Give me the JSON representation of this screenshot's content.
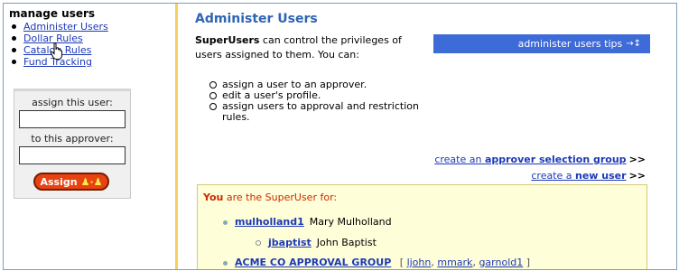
{
  "sidebar": {
    "title": "manage users",
    "nav": [
      {
        "label": "Administer Users"
      },
      {
        "label": "Dollar Rules"
      },
      {
        "label": "Catalog Rules"
      },
      {
        "label": "Fund Tracking"
      }
    ],
    "assign_box": {
      "user_label": "assign this user:",
      "user_value": "",
      "approver_label": "to this approver:",
      "approver_value": "",
      "button_label": "Assign"
    }
  },
  "main": {
    "title": "Administer Users",
    "intro_bold": "SuperUsers",
    "intro_rest": " can control the privileges of users assigned to them. You can:",
    "tips_label": "administer users tips",
    "capabilities": [
      "assign a user to an approver.",
      "edit a user's profile.",
      "assign users to approval and restriction rules."
    ],
    "actions": {
      "approver_group_prefix": "create an ",
      "approver_group_bold": "approver selection group",
      "approver_group_arrow": ">>",
      "new_user_prefix": "create a ",
      "new_user_bold": "new user",
      "new_user_arrow": ">>"
    },
    "superuser_panel": {
      "header_you": "You",
      "header_rest": " are the SuperUser for:",
      "user1_login": "mulholland1",
      "user1_name": "Mary Mulholland",
      "user2_login": "jbaptist",
      "user2_name": "John Baptist",
      "group_name": "ACME CO APPROVAL GROUP",
      "group_open": "[",
      "group_members": [
        "ljohn",
        "mmark",
        "garnold1"
      ],
      "group_close": "]"
    }
  },
  "colors": {
    "title_blue": "#2e64b4",
    "link_blue": "#1c39b8",
    "tips_bar": "#3d6bd7",
    "assign_button": "#e84210",
    "panel_bg": "#fefed8",
    "divider": "#f6cf5e",
    "you_red": "#cc2a00"
  },
  "icons": [
    "hand-cursor-icon",
    "arrows-icon",
    "assign-people-icon"
  ]
}
